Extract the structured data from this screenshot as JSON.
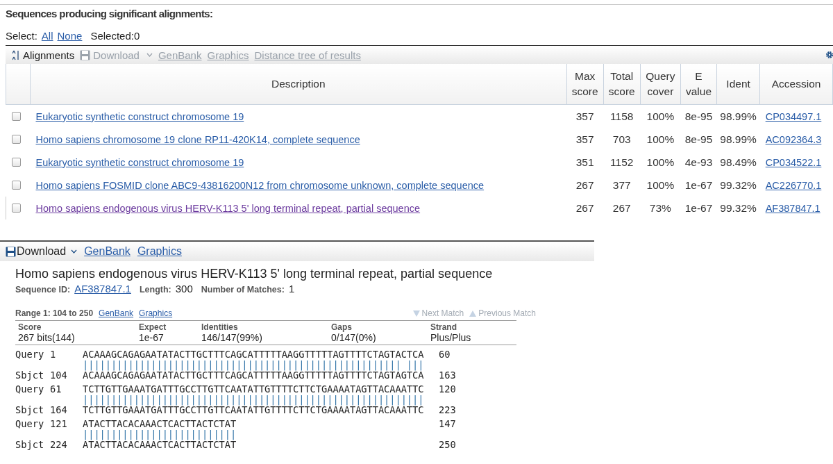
{
  "heading": "Sequences producing significant alignments:",
  "select": {
    "label": "Select:",
    "links": [
      "All",
      "None"
    ],
    "selected_text": "Selected:0"
  },
  "toolbar": [
    {
      "kind": "sort",
      "label": "Alignments",
      "disabled": false
    },
    {
      "kind": "download",
      "label": "Download",
      "disabled": true
    },
    {
      "kind": "link",
      "label": "GenBank",
      "disabled": true
    },
    {
      "kind": "link",
      "label": "Graphics",
      "disabled": true
    },
    {
      "kind": "link",
      "label": "Distance tree of results",
      "disabled": true
    }
  ],
  "table": {
    "columns": [
      [
        "Description"
      ],
      [
        "Max",
        "score"
      ],
      [
        "Total",
        "score"
      ],
      [
        "Query",
        "cover"
      ],
      [
        "E",
        "value"
      ],
      [
        "Ident"
      ],
      [
        "Accession"
      ]
    ],
    "rows": [
      {
        "checked": false,
        "visited": false,
        "description": "Eukaryotic synthetic construct chromosome 19",
        "max_score": "357",
        "total_score": "1158",
        "query_cover": "100%",
        "e_value": "8e-95",
        "ident": "98.99%",
        "accession": "CP034497.1"
      },
      {
        "checked": false,
        "visited": false,
        "description": "Homo sapiens chromosome 19 clone RP11-420K14, complete sequence",
        "max_score": "357",
        "total_score": "703",
        "query_cover": "100%",
        "e_value": "8e-95",
        "ident": "98.99%",
        "accession": "AC092364.3"
      },
      {
        "checked": false,
        "visited": false,
        "description": "Eukaryotic synthetic construct chromosome 19",
        "max_score": "351",
        "total_score": "1152",
        "query_cover": "100%",
        "e_value": "4e-93",
        "ident": "98.49%",
        "accession": "CP034522.1"
      },
      {
        "checked": false,
        "visited": false,
        "description": "Homo sapiens FOSMID clone ABC9-43816200N12 from chromosome unknown, complete sequence",
        "max_score": "267",
        "total_score": "377",
        "query_cover": "100%",
        "e_value": "1e-67",
        "ident": "99.32%",
        "accession": "AC226770.1"
      },
      {
        "checked": false,
        "visited": true,
        "description": "Homo sapiens endogenous virus HERV-K113 5' long terminal repeat, partial sequence",
        "max_score": "267",
        "total_score": "267",
        "query_cover": "73%",
        "e_value": "1e-67",
        "ident": "99.32%",
        "accession": "AF387847.1"
      }
    ]
  },
  "detail_toolbar": [
    {
      "kind": "download",
      "label": "Download"
    },
    {
      "kind": "link",
      "label": "GenBank"
    },
    {
      "kind": "link",
      "label": "Graphics"
    }
  ],
  "detail": {
    "title": "Homo sapiens endogenous virus HERV-K113 5' long terminal repeat, partial sequence",
    "meta": [
      {
        "label": "Sequence ID:",
        "value": "AF387847.1",
        "link": true
      },
      {
        "label": "Length:",
        "value": "300",
        "link": false
      },
      {
        "label": "Number of Matches:",
        "value": "1",
        "link": false
      }
    ],
    "range": {
      "label": "Range 1: 104 to 250",
      "links": [
        "GenBank",
        "Graphics"
      ],
      "next": "Next Match",
      "previous": "Previous Match"
    },
    "stats": [
      {
        "label": "Score",
        "value": "267 bits(144)"
      },
      {
        "label": "Expect",
        "value": "1e-67"
      },
      {
        "label": "Identities",
        "value": "146/147(99%)"
      },
      {
        "label": "Gaps",
        "value": "0/147(0%)"
      },
      {
        "label": "Strand",
        "value": "Plus/Plus"
      }
    ],
    "blocks": [
      {
        "query": [
          "Query",
          "1",
          "ACAAAGCAGAGAATATACTTGCTTTCAGCATTTTTAAGGTTTTTAGTTTTCTAGTACTCA",
          "60"
        ],
        "match": "|||||||||||||||||||||||||||||||||||||||||||||||||||||||| |||",
        "sbjct": [
          "Sbjct",
          "104",
          "ACAAAGCAGAGAATATACTTGCTTTCAGCATTTTTAAGGTTTTTAGTTTTCTAGTAGTCA",
          "163"
        ]
      },
      {
        "query": [
          "Query",
          "61",
          "TCTTGTTGAAATGATTTGCCTTGTTCAATATTGTTTTCTTCTGAAAATAGTTACAAATTC",
          "120"
        ],
        "match": "||||||||||||||||||||||||||||||||||||||||||||||||||||||||||||",
        "sbjct": [
          "Sbjct",
          "164",
          "TCTTGTTGAAATGATTTGCCTTGTTCAATATTGTTTTCTTCTGAAAATAGTTACAAATTC",
          "223"
        ]
      },
      {
        "query": [
          "Query",
          "121",
          "ATACTTACACAAACTCACTTACTCTAT",
          "147"
        ],
        "match": "|||||||||||||||||||||||||||",
        "sbjct": [
          "Sbjct",
          "224",
          "ATACTTACACAAACTCACTTACTCTAT",
          "250"
        ]
      }
    ]
  }
}
